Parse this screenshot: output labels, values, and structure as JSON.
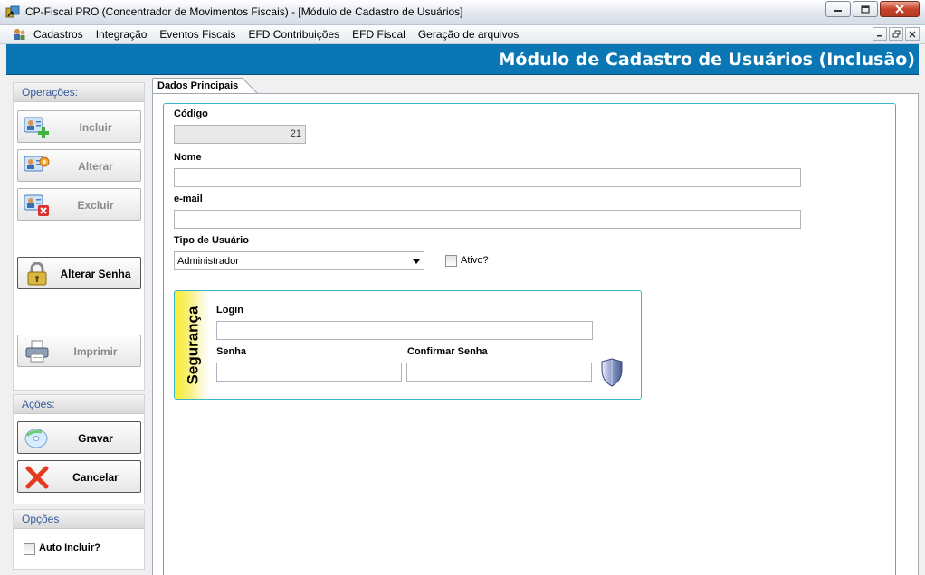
{
  "window": {
    "title": "CP-Fiscal PRO (Concentrador de Movimentos Fiscais) - [Módulo de Cadastro de Usuários]"
  },
  "menu": {
    "items": [
      "Cadastros",
      "Integração",
      "Eventos Fiscais",
      "EFD Contribuições",
      "EFD Fiscal",
      "Geração de arquivos"
    ]
  },
  "banner": {
    "title": "Módulo de Cadastro de Usuários (Inclusão)"
  },
  "left_panel": {
    "operacoes": {
      "header": "Operações:",
      "incluir": "Incluir",
      "alterar": "Alterar",
      "excluir": "Excluir",
      "alterar_senha": "Alterar Senha",
      "imprimir": "Imprimir"
    },
    "acoes": {
      "header": "Ações:",
      "gravar": "Gravar",
      "cancelar": "Cancelar"
    },
    "opcoes": {
      "header": "Opções",
      "auto_incluir": "Auto Incluir?"
    }
  },
  "tab": {
    "label": "Dados Principais"
  },
  "form": {
    "codigo": {
      "label": "Código",
      "value": "21"
    },
    "nome": {
      "label": "Nome",
      "value": ""
    },
    "email": {
      "label": "e-mail",
      "value": ""
    },
    "tipo_usuario": {
      "label": "Tipo de Usuário",
      "value": "Administrador"
    },
    "ativo": {
      "label": "Ativo?",
      "checked": false
    },
    "seguranca": {
      "title": "Segurança",
      "login": {
        "label": "Login",
        "value": ""
      },
      "senha": {
        "label": "Senha",
        "value": ""
      },
      "confirmar_senha": {
        "label": "Confirmar Senha",
        "value": ""
      }
    }
  },
  "colors": {
    "banner": "#0a76b4",
    "accent_border": "#3cb6c6",
    "panel_header_text": "#335a9c"
  }
}
